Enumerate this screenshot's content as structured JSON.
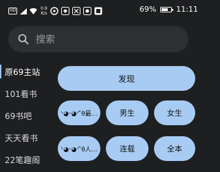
{
  "status_bar": {
    "network_badge": "HD",
    "speed_value": "0.9",
    "speed_unit": "K/s",
    "battery_percent": "69%",
    "battery_level": 0.69,
    "time": "11:11"
  },
  "search": {
    "placeholder": "搜索"
  },
  "sidebar": {
    "items": [
      {
        "label": "原69主站"
      },
      {
        "label": "101看书"
      },
      {
        "label": "69书吧"
      },
      {
        "label": "天天看书"
      },
      {
        "label": "22笔趣阁"
      }
    ]
  },
  "buttons": {
    "discover": "发现",
    "kaomoji_1": "ᐠ◕ᵕ◕ᐟ ̑̑θ最…",
    "male": "男生",
    "female": "女生",
    "kaomoji_2": "ᐠ◕ᵕ◕ᐟ ̑̑θ人…",
    "serial": "连载",
    "complete": "全本"
  },
  "colors": {
    "background": "#1e1f21",
    "accent": "#a7cbf3",
    "search_bg": "#2e2f33"
  }
}
